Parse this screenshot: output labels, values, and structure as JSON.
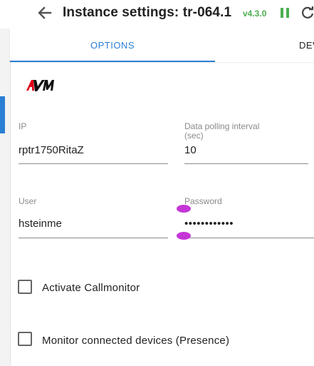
{
  "header": {
    "title": "Instance settings: tr-064.1",
    "version": "v4.3.0"
  },
  "tabs": [
    {
      "label": "OPTIONS"
    },
    {
      "label": "DEV"
    }
  ],
  "colors": {
    "accent": "#2a7fd4",
    "status_green": "#4caf50",
    "selection_handle": "#c436d6"
  },
  "form": {
    "ip": {
      "label": "IP",
      "value": "rptr1750RitaZ"
    },
    "polling": {
      "label_line1": "Data polling interval",
      "label_line2": "(sec)",
      "value": "10"
    },
    "user": {
      "label": "User",
      "value": "hsteinme"
    },
    "password": {
      "label": "Password",
      "value": "••••••••••••"
    }
  },
  "checkboxes": [
    {
      "label": "Activate Callmonitor",
      "checked": false
    },
    {
      "label": "Monitor connected devices (Presence)",
      "checked": false
    }
  ]
}
